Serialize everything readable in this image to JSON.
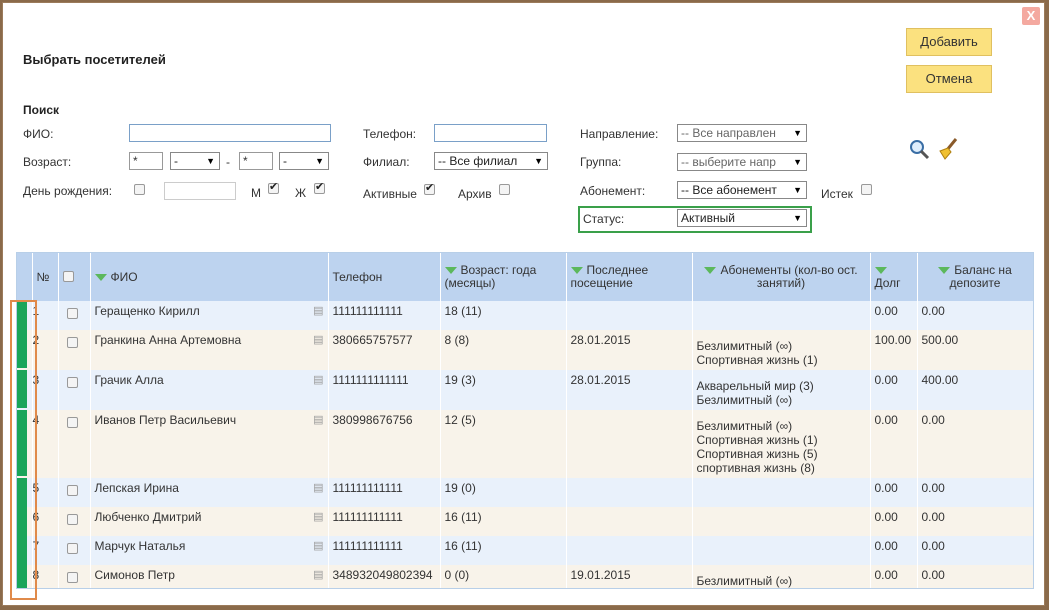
{
  "dialog": {
    "title": "Выбрать посетителей",
    "close_label": "X"
  },
  "buttons": {
    "add": "Добавить",
    "cancel": "Отмена"
  },
  "search": {
    "heading": "Поиск",
    "fio_label": "ФИО:",
    "fio_value": "",
    "phone_label": "Телефон:",
    "phone_value": "",
    "direction_label": "Направление:",
    "direction_value": "-- Все направлен",
    "age_label": "Возраст:",
    "age_from": "*",
    "age_from_unit": "-",
    "age_sep": "-",
    "age_to": "*",
    "age_to_unit": "-",
    "branch_label": "Филиал:",
    "branch_value": "-- Все филиал",
    "group_label": "Группа:",
    "group_value": "-- выберите напр",
    "birthday_label": "День рождения:",
    "birthday_value": "",
    "m_label": "М",
    "f_label": "Ж",
    "active_label": "Активные",
    "archive_label": "Архив",
    "subscription_label": "Абонемент:",
    "subscription_value": "-- Все абонемент",
    "expired_label": "Истек",
    "status_label": "Статус:",
    "status_value": "Активный"
  },
  "icons": {
    "search": "magnifier-icon",
    "clear": "broom-icon"
  },
  "table": {
    "headers": [
      "№",
      "",
      "ФИО",
      "Телефон",
      "Возраст: года (месяцы)",
      "Последнее посещение",
      "Абонементы (кол-во ост. занятий)",
      "Долг",
      "Баланс на депозите"
    ],
    "rows": [
      {
        "n": "1",
        "name": "Геращенко Кирилл",
        "phone": "111111111111",
        "age": "18 (11)",
        "last": "",
        "subs": [],
        "debt": "0.00",
        "balance": "0.00"
      },
      {
        "n": "2",
        "name": "Гранкина Анна Артемовна",
        "phone": "380665757577",
        "age": "8 (8)",
        "last": "28.01.2015",
        "subs": [
          "Безлимитный (∞)",
          "Спортивная жизнь (1)"
        ],
        "debt": "100.00",
        "balance": "500.00"
      },
      {
        "n": "3",
        "name": "Грачик Алла",
        "phone": "1111111111111",
        "age": "19 (3)",
        "last": "28.01.2015",
        "subs": [
          "Акварельный мир (3)",
          "Безлимитный (∞)"
        ],
        "debt": "0.00",
        "balance": "400.00"
      },
      {
        "n": "4",
        "name": "Иванов Петр Васильевич",
        "phone": "380998676756",
        "age": "12 (5)",
        "last": "",
        "subs": [
          "Безлимитный (∞)",
          "Спортивная жизнь (1)",
          "Спортивная жизнь (5)",
          "спортивная жизнь (8)"
        ],
        "debt": "0.00",
        "balance": "0.00"
      },
      {
        "n": "5",
        "name": "Лепская Ирина",
        "phone": "111111111111",
        "age": "19 (0)",
        "last": "",
        "subs": [],
        "debt": "0.00",
        "balance": "0.00"
      },
      {
        "n": "6",
        "name": "Любченко Дмитрий",
        "phone": "111111111111",
        "age": "16 (11)",
        "last": "",
        "subs": [],
        "debt": "0.00",
        "balance": "0.00"
      },
      {
        "n": "7",
        "name": "Марчук Наталья",
        "phone": "111111111111",
        "age": "16 (11)",
        "last": "",
        "subs": [],
        "debt": "0.00",
        "balance": "0.00"
      },
      {
        "n": "8",
        "name": "Симонов Петр",
        "phone": "348932049802394",
        "age": "0 (0)",
        "last": "19.01.2015",
        "subs": [
          "Безлимитный (∞)"
        ],
        "debt": "0.00",
        "balance": "0.00"
      }
    ]
  },
  "colors": {
    "accent": "#fbe17f",
    "header": "#bdd3ef",
    "status_bar": "#1aa55a",
    "highlight_status": "#3aa04a",
    "highlight_rows": "#e08a4a"
  }
}
